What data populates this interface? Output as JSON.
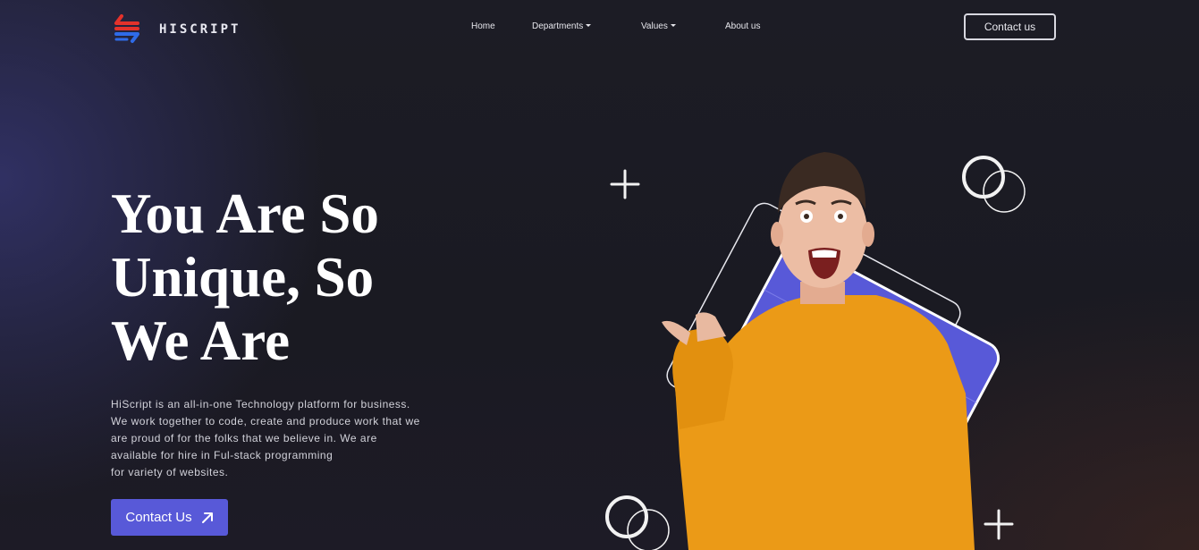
{
  "header": {
    "brand": "HISCRIPT",
    "nav": [
      {
        "label": "Home",
        "has_dropdown": false
      },
      {
        "label": "Departments",
        "has_dropdown": true
      },
      {
        "label": "Values",
        "has_dropdown": true
      },
      {
        "label": "About us",
        "has_dropdown": false
      }
    ],
    "cta_label": "Contact us"
  },
  "hero": {
    "title_lines": [
      "You Are So",
      "Unique, So",
      "We Are"
    ],
    "description_lines": [
      "HiScript is an all-in-one Technology platform for business.",
      "We work together to code, create and produce work that we",
      "are proud of for the folks that we believe in. We are",
      "available for hire in Ful-stack programming",
      "for variety of websites."
    ],
    "cta_label": "Contact Us",
    "cta_icon": "arrow-up-right-icon"
  },
  "illustration": {
    "subject": "person-pointing-icon",
    "decorations": [
      "plus-icon",
      "double-circle-icon"
    ]
  },
  "colors": {
    "accent": "#5859d8",
    "card_fill": "#5859d8",
    "sweater": "#eb9a17",
    "logo_red": "#e4322b",
    "logo_blue": "#2f6be8",
    "background": "#1c1c25"
  }
}
